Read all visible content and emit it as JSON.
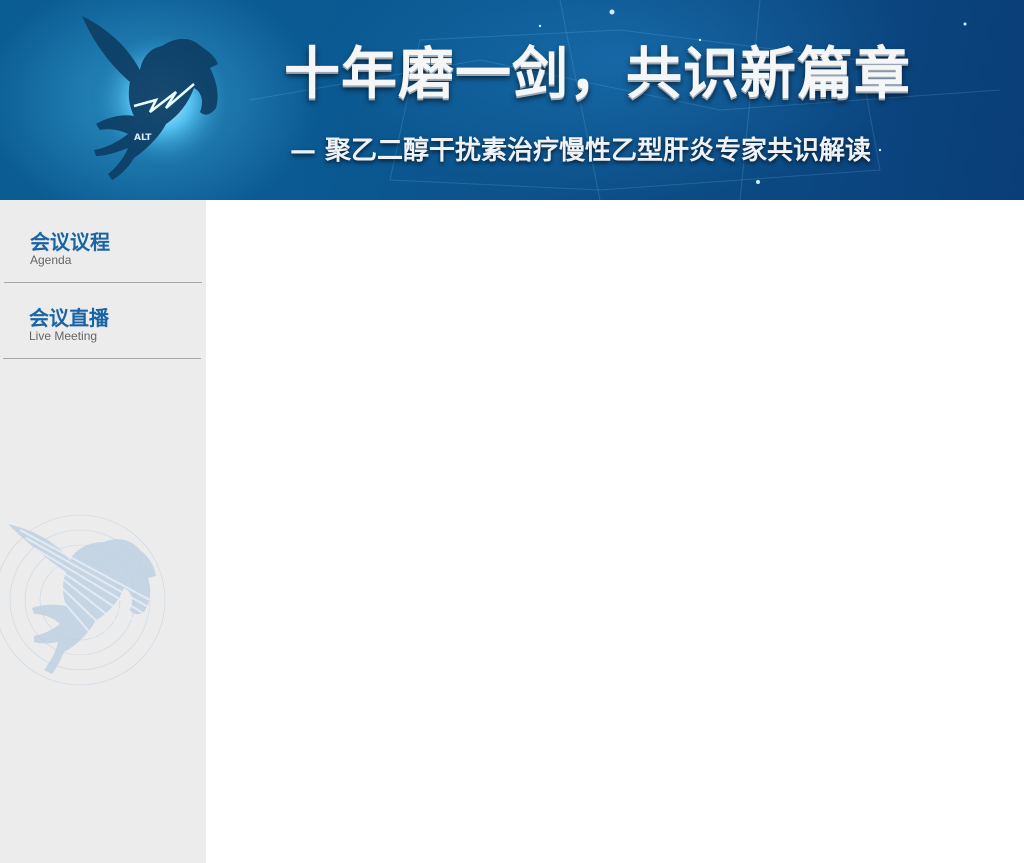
{
  "banner": {
    "logo_text": "ALT",
    "title": "十年磨一剑，共识新篇章",
    "subtitle": "— 聚乙二醇干扰素治疗慢性乙型肝炎专家共识解读",
    "logo_icon": "pegasus-icon"
  },
  "sidebar": {
    "items": [
      {
        "label_zh": "会议议程",
        "label_en": "Agenda"
      },
      {
        "label_zh": "会议直播",
        "label_en": "Live Meeting"
      }
    ],
    "watermark_icon": "pegasus-watermark-icon"
  },
  "colors": {
    "banner_blue": "#0b5a93",
    "nav_text_blue": "#1a64a6",
    "sidebar_bg": "#ececec"
  }
}
